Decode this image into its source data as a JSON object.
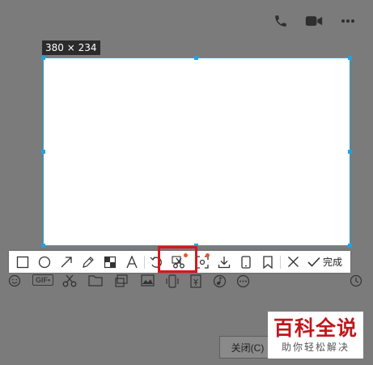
{
  "screenshot": {
    "size_label": "380 × 234"
  },
  "toolbar": {
    "tools": [
      "rectangle-tool",
      "ellipse-tool",
      "arrow-tool",
      "pencil-tool",
      "mosaic-tool",
      "text-tool",
      "undo-tool",
      "scissors-tool",
      "screen-recognition-tool",
      "download-tool",
      "phone-tool",
      "pin-tool",
      "close-tool",
      "done"
    ],
    "done_label": "完成"
  },
  "footer": {
    "close_label": "关闭(C)"
  },
  "watermark": {
    "title": "百科全说",
    "subtitle": "助你轻松解决"
  },
  "colors": {
    "selection_border": "#26a0da",
    "highlight": "#d9161c",
    "badge": "#e8572a",
    "overlay": "#7b7b7b"
  }
}
